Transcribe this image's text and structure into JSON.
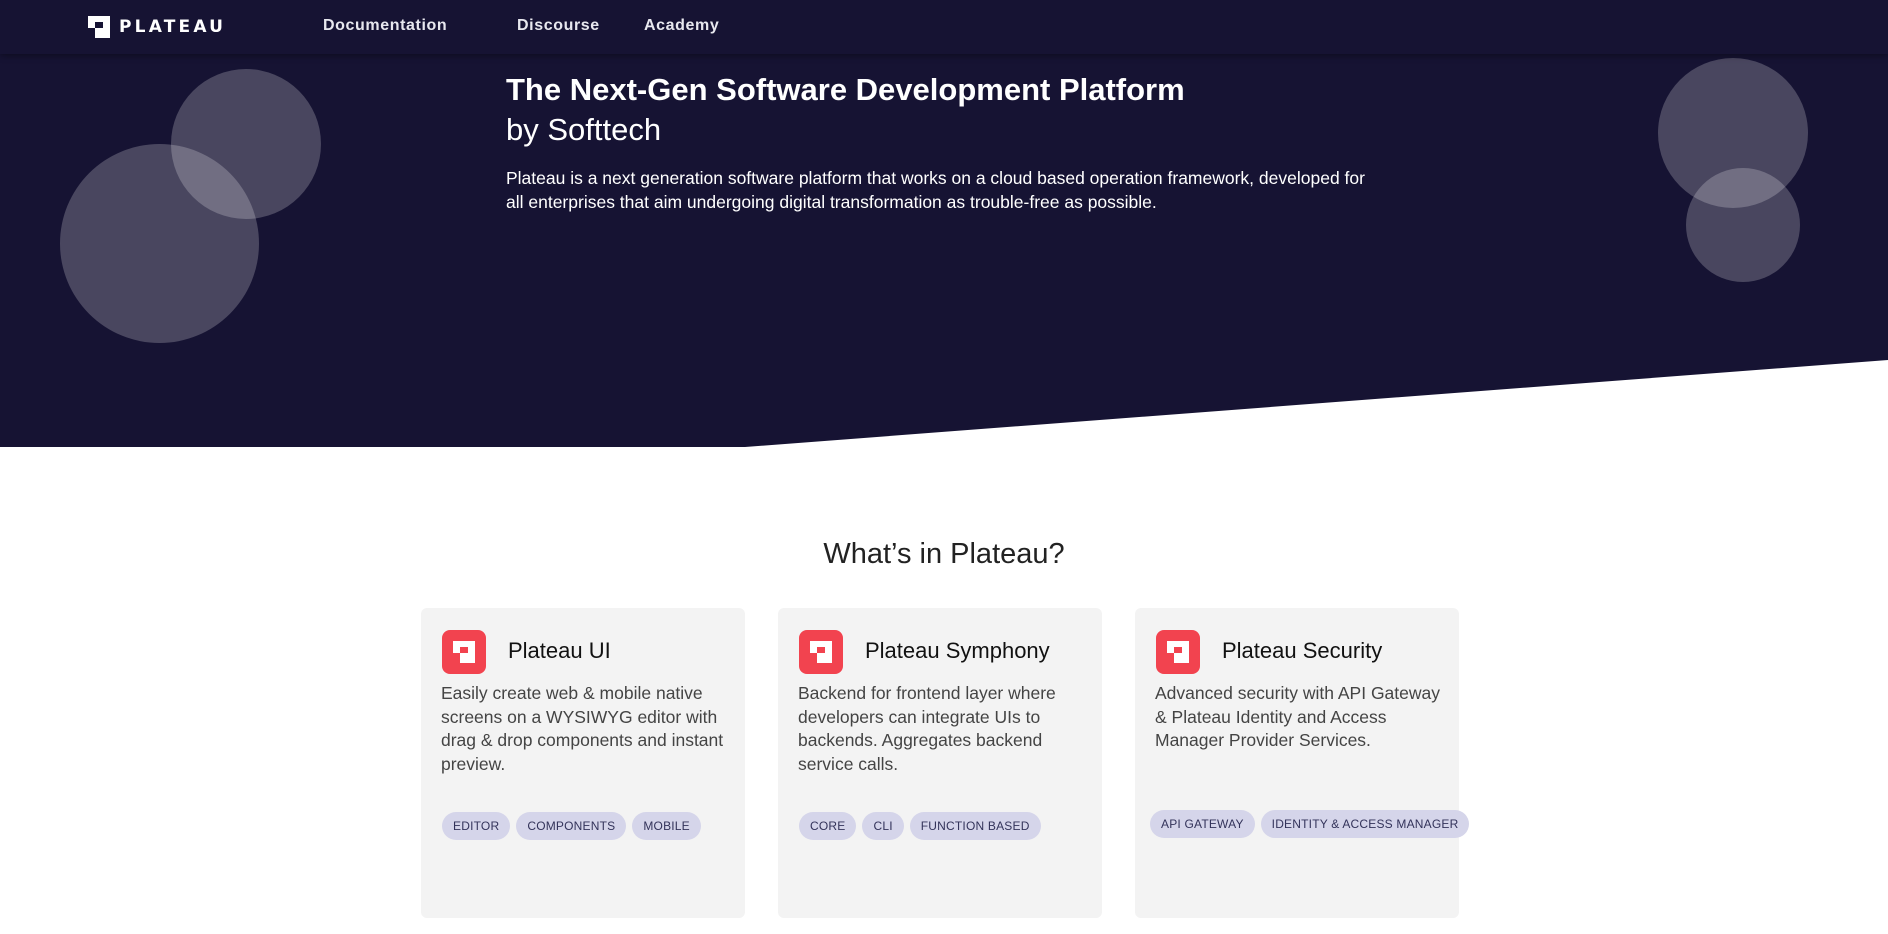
{
  "nav": {
    "logo_text": "PLATEAU",
    "links": [
      "Documentation",
      "Discourse",
      "Academy"
    ]
  },
  "hero": {
    "title": "The Next-Gen Software Development Platform",
    "subtitle": "by Softtech",
    "description": "Plateau is a next generation software platform that works on a cloud based operation framework, developed for all enterprises that aim undergoing digital transformation as trouble-free as possible."
  },
  "section": {
    "title": "What’s in Plateau?"
  },
  "cards": [
    {
      "title": "Plateau UI",
      "description": "Easily create web & mobile native screens on a WYSIWYG editor with drag & drop components and instant preview.",
      "tags": [
        "EDITOR",
        "COMPONENTS",
        "MOBILE"
      ]
    },
    {
      "title": "Plateau Symphony",
      "description": "Backend for frontend layer where developers can integrate UIs to backends. Aggregates backend service calls.",
      "tags": [
        "CORE",
        "CLI",
        "FUNCTION BASED"
      ]
    },
    {
      "title": "Plateau Security",
      "description": "Advanced security with API Gateway & Plateau Identity and Access Manager Provider Services.",
      "tags": [
        "API GATEWAY",
        "IDENTITY & ACCESS MANAGER"
      ]
    }
  ],
  "colors": {
    "hero_bg": "#161333",
    "accent": "#f2434f",
    "tag_bg": "#d5d5ea",
    "card_bg": "#f3f3f3"
  },
  "icons": {
    "brand": "plateau-logo-icon"
  }
}
